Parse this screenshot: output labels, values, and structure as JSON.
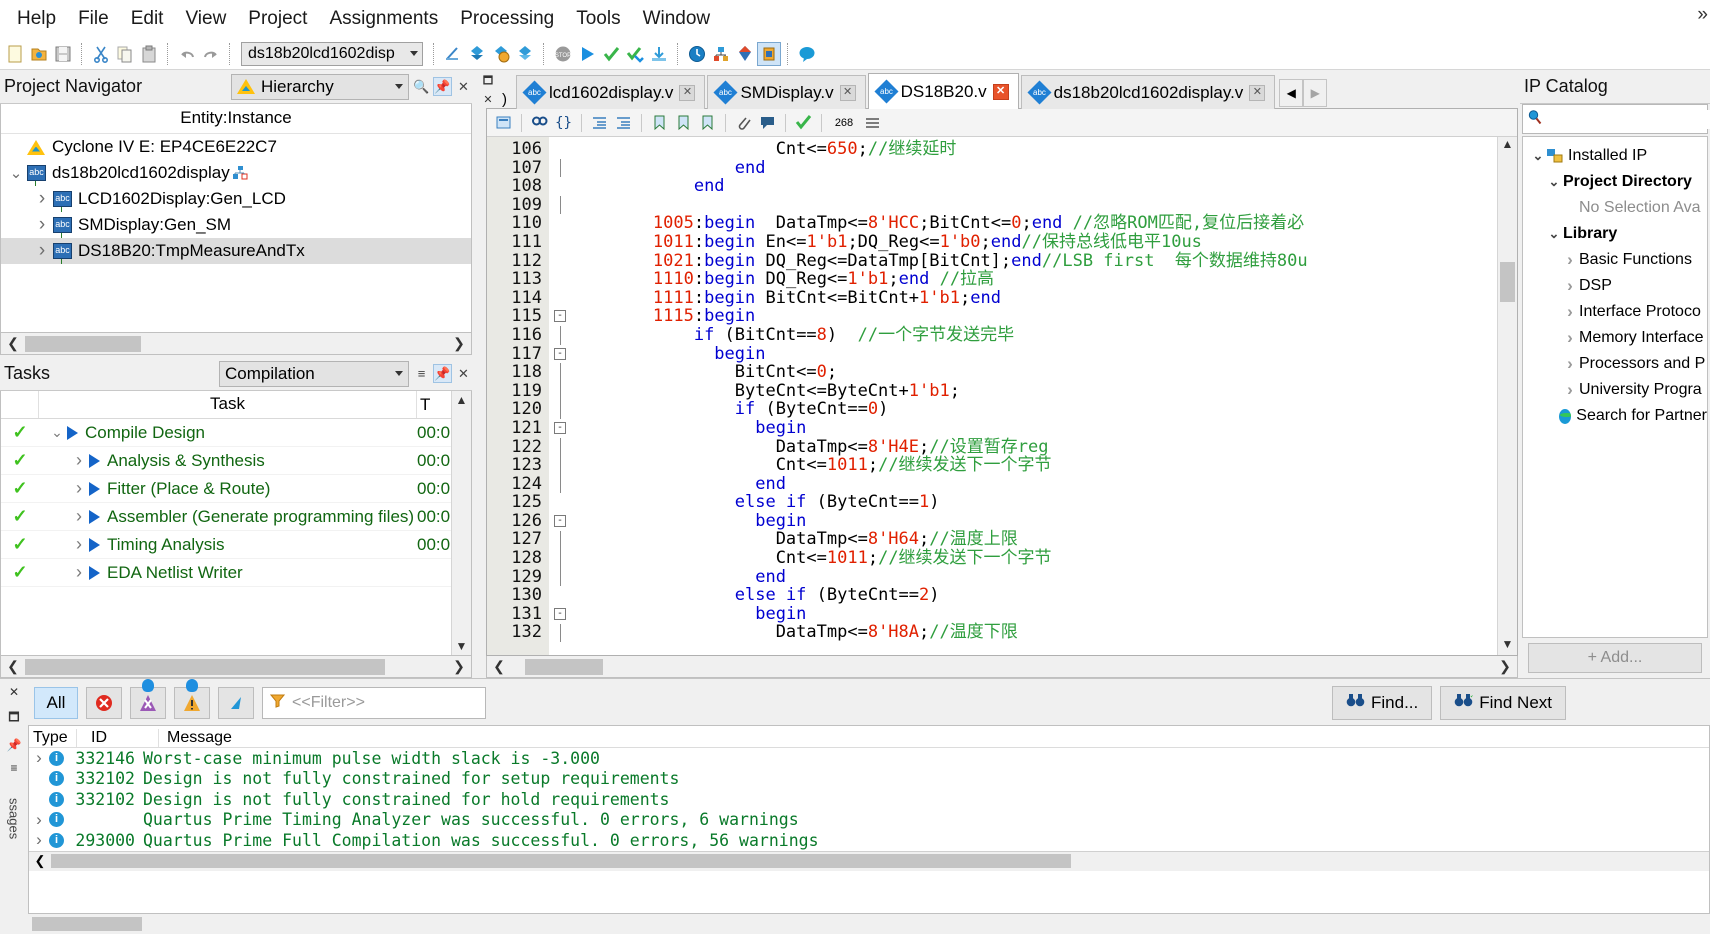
{
  "menu": {
    "items": [
      "File",
      "Edit",
      "View",
      "Project",
      "Assignments",
      "Processing",
      "Tools",
      "Window",
      "Help"
    ],
    "overflow": "»"
  },
  "toolbar": {
    "project_combo_value": "ds18b20lcd1602disp",
    "icons": [
      "new-file-icon",
      "open-folder-icon",
      "save-icon",
      "cut-icon",
      "copy-icon",
      "paste-icon",
      "undo-icon",
      "redo-icon",
      "compile-icon",
      "analysis-synthesis-icon",
      "analysis-elaboration-icon",
      "fitter-icon",
      "stop-icon",
      "start-compilation-icon",
      "timing-analyzer-icon",
      "programmer-icon",
      "download-icon",
      "clock-icon",
      "pin-planner-icon",
      "netlist-viewer-icon",
      "rtl-viewer-icon",
      "help-balloon-icon"
    ]
  },
  "project_navigator": {
    "title": "Project Navigator",
    "view_selector": "Hierarchy",
    "column_header": "Entity:Instance",
    "nodes": [
      {
        "label": "Cyclone IV E: EP4CE6E22C7",
        "depth": 0,
        "icon": "device-warning-icon",
        "twisty": "",
        "selected": false
      },
      {
        "label": "ds18b20lcd1602display",
        "depth": 0,
        "icon": "verilog-file-icon",
        "twisty": "expanded",
        "selected": false
      },
      {
        "label": "LCD1602Display:Gen_LCD",
        "depth": 1,
        "icon": "verilog-file-icon",
        "twisty": "collapsed",
        "selected": false
      },
      {
        "label": "SMDisplay:Gen_SM",
        "depth": 1,
        "icon": "verilog-file-icon",
        "twisty": "collapsed",
        "selected": false
      },
      {
        "label": "DS18B20:TmpMeasureAndTx",
        "depth": 1,
        "icon": "verilog-file-icon",
        "twisty": "collapsed",
        "selected": true
      }
    ]
  },
  "tasks": {
    "title": "Tasks",
    "flow_selector": "Compilation",
    "columns": {
      "task": "Task",
      "time": "T"
    },
    "rows": [
      {
        "label": "Compile Design",
        "time": "00:0",
        "depth": 0,
        "twisty": "expanded",
        "status": "done"
      },
      {
        "label": "Analysis & Synthesis",
        "time": "00:0",
        "depth": 1,
        "twisty": "collapsed",
        "status": "done"
      },
      {
        "label": "Fitter (Place & Route)",
        "time": "00:0",
        "depth": 1,
        "twisty": "collapsed",
        "status": "done"
      },
      {
        "label": "Assembler (Generate programming files)",
        "time": "00:0",
        "depth": 1,
        "twisty": "collapsed",
        "status": "done"
      },
      {
        "label": "Timing Analysis",
        "time": "00:0",
        "depth": 1,
        "twisty": "collapsed",
        "status": "done"
      },
      {
        "label": "EDA Netlist Writer",
        "time": "",
        "depth": 1,
        "twisty": "collapsed",
        "status": "done"
      }
    ]
  },
  "editor": {
    "tabs": [
      {
        "label": "lcd1602display.v",
        "active": false,
        "close_state": "normal"
      },
      {
        "label": "SMDisplay.v",
        "active": false,
        "close_state": "normal"
      },
      {
        "label": "DS18B20.v",
        "active": true,
        "close_state": "modified"
      },
      {
        "label": "ds18b20lcd1602display.v",
        "active": false,
        "close_state": "normal"
      }
    ],
    "toolbar_line_count": "268",
    "first_line_number": 106,
    "lines": [
      {
        "n": 106,
        "fold": "",
        "segs": [
          {
            "t": "                    Cnt<=",
            "c": ""
          },
          {
            "t": "650",
            "c": "num"
          },
          {
            "t": ";",
            "c": ""
          },
          {
            "t": "//继续延时",
            "c": "cm"
          }
        ]
      },
      {
        "n": 107,
        "fold": "bar",
        "segs": [
          {
            "t": "                ",
            "c": ""
          },
          {
            "t": "end",
            "c": "kw"
          }
        ]
      },
      {
        "n": 108,
        "fold": "",
        "segs": [
          {
            "t": "            ",
            "c": ""
          },
          {
            "t": "end",
            "c": "kw"
          }
        ]
      },
      {
        "n": 109,
        "fold": "bar",
        "segs": [
          {
            "t": "",
            "c": ""
          }
        ]
      },
      {
        "n": 110,
        "fold": "",
        "segs": [
          {
            "t": "        ",
            "c": ""
          },
          {
            "t": "1005",
            "c": "num"
          },
          {
            "t": ":",
            "c": ""
          },
          {
            "t": "begin",
            "c": "kw"
          },
          {
            "t": "  DataTmp<=",
            "c": ""
          },
          {
            "t": "8",
            "c": "num"
          },
          {
            "t": "'HCC",
            "c": "st"
          },
          {
            "t": ";BitCnt<=",
            "c": ""
          },
          {
            "t": "0",
            "c": "num"
          },
          {
            "t": ";",
            "c": ""
          },
          {
            "t": "end",
            "c": "kw"
          },
          {
            "t": " //忽略ROM匹配,复位后接着必",
            "c": "cm"
          }
        ]
      },
      {
        "n": 111,
        "fold": "",
        "segs": [
          {
            "t": "        ",
            "c": ""
          },
          {
            "t": "1011",
            "c": "num"
          },
          {
            "t": ":",
            "c": ""
          },
          {
            "t": "begin",
            "c": "kw"
          },
          {
            "t": " En<=",
            "c": ""
          },
          {
            "t": "1",
            "c": "num"
          },
          {
            "t": "'b1",
            "c": "st"
          },
          {
            "t": ";DQ_Reg<=",
            "c": ""
          },
          {
            "t": "1",
            "c": "num"
          },
          {
            "t": "'b0",
            "c": "st"
          },
          {
            "t": ";",
            "c": ""
          },
          {
            "t": "end",
            "c": "kw"
          },
          {
            "t": "//保持总线低电平10us",
            "c": "cm"
          }
        ]
      },
      {
        "n": 112,
        "fold": "",
        "segs": [
          {
            "t": "        ",
            "c": ""
          },
          {
            "t": "1021",
            "c": "num"
          },
          {
            "t": ":",
            "c": ""
          },
          {
            "t": "begin",
            "c": "kw"
          },
          {
            "t": " DQ_Reg<=DataTmp[BitCnt];",
            "c": ""
          },
          {
            "t": "end",
            "c": "kw"
          },
          {
            "t": "//LSB first  每个数据维持80u",
            "c": "cm"
          }
        ]
      },
      {
        "n": 113,
        "fold": "",
        "segs": [
          {
            "t": "        ",
            "c": ""
          },
          {
            "t": "1110",
            "c": "num"
          },
          {
            "t": ":",
            "c": ""
          },
          {
            "t": "begin",
            "c": "kw"
          },
          {
            "t": " DQ_Reg<=",
            "c": ""
          },
          {
            "t": "1",
            "c": "num"
          },
          {
            "t": "'b1",
            "c": "st"
          },
          {
            "t": ";",
            "c": ""
          },
          {
            "t": "end",
            "c": "kw"
          },
          {
            "t": " //拉高",
            "c": "cm"
          }
        ]
      },
      {
        "n": 114,
        "fold": "",
        "segs": [
          {
            "t": "        ",
            "c": ""
          },
          {
            "t": "1111",
            "c": "num"
          },
          {
            "t": ":",
            "c": ""
          },
          {
            "t": "begin",
            "c": "kw"
          },
          {
            "t": " BitCnt<=BitCnt+",
            "c": ""
          },
          {
            "t": "1",
            "c": "num"
          },
          {
            "t": "'b1",
            "c": "st"
          },
          {
            "t": ";",
            "c": ""
          },
          {
            "t": "end",
            "c": "kw"
          }
        ]
      },
      {
        "n": 115,
        "fold": "minus",
        "segs": [
          {
            "t": "        ",
            "c": ""
          },
          {
            "t": "1115",
            "c": "num"
          },
          {
            "t": ":",
            "c": ""
          },
          {
            "t": "begin",
            "c": "kw"
          }
        ]
      },
      {
        "n": 116,
        "fold": "bar",
        "segs": [
          {
            "t": "            ",
            "c": ""
          },
          {
            "t": "if",
            "c": "kw"
          },
          {
            "t": " (BitCnt==",
            "c": ""
          },
          {
            "t": "8",
            "c": "num"
          },
          {
            "t": ")  ",
            "c": ""
          },
          {
            "t": "//一个字节发送完毕",
            "c": "cm"
          }
        ]
      },
      {
        "n": 117,
        "fold": "minus",
        "segs": [
          {
            "t": "              ",
            "c": ""
          },
          {
            "t": "begin",
            "c": "kw"
          }
        ]
      },
      {
        "n": 118,
        "fold": "bar",
        "segs": [
          {
            "t": "                BitCnt<=",
            "c": ""
          },
          {
            "t": "0",
            "c": "num"
          },
          {
            "t": ";",
            "c": ""
          }
        ]
      },
      {
        "n": 119,
        "fold": "bar",
        "segs": [
          {
            "t": "                ByteCnt<=ByteCnt+",
            "c": ""
          },
          {
            "t": "1",
            "c": "num"
          },
          {
            "t": "'b1",
            "c": "st"
          },
          {
            "t": ";",
            "c": ""
          }
        ]
      },
      {
        "n": 120,
        "fold": "bar",
        "segs": [
          {
            "t": "                ",
            "c": ""
          },
          {
            "t": "if",
            "c": "kw"
          },
          {
            "t": " (ByteCnt==",
            "c": ""
          },
          {
            "t": "0",
            "c": "num"
          },
          {
            "t": ")",
            "c": ""
          }
        ]
      },
      {
        "n": 121,
        "fold": "minus",
        "segs": [
          {
            "t": "                  ",
            "c": ""
          },
          {
            "t": "begin",
            "c": "kw"
          }
        ]
      },
      {
        "n": 122,
        "fold": "bar",
        "segs": [
          {
            "t": "                    DataTmp<=",
            "c": ""
          },
          {
            "t": "8",
            "c": "num"
          },
          {
            "t": "'H4E",
            "c": "st"
          },
          {
            "t": ";",
            "c": ""
          },
          {
            "t": "//设置暂存reg",
            "c": "cm"
          }
        ]
      },
      {
        "n": 123,
        "fold": "bar",
        "segs": [
          {
            "t": "                    Cnt<=",
            "c": ""
          },
          {
            "t": "1011",
            "c": "num"
          },
          {
            "t": ";",
            "c": ""
          },
          {
            "t": "//继续发送下一个字节",
            "c": "cm"
          }
        ]
      },
      {
        "n": 124,
        "fold": "bar",
        "segs": [
          {
            "t": "                  ",
            "c": ""
          },
          {
            "t": "end",
            "c": "kw"
          }
        ]
      },
      {
        "n": 125,
        "fold": "",
        "segs": [
          {
            "t": "                ",
            "c": ""
          },
          {
            "t": "else if",
            "c": "kw"
          },
          {
            "t": " (ByteCnt==",
            "c": ""
          },
          {
            "t": "1",
            "c": "num"
          },
          {
            "t": ")",
            "c": ""
          }
        ]
      },
      {
        "n": 126,
        "fold": "minus",
        "segs": [
          {
            "t": "                  ",
            "c": ""
          },
          {
            "t": "begin",
            "c": "kw"
          }
        ]
      },
      {
        "n": 127,
        "fold": "bar",
        "segs": [
          {
            "t": "                    DataTmp<=",
            "c": ""
          },
          {
            "t": "8",
            "c": "num"
          },
          {
            "t": "'H64",
            "c": "st"
          },
          {
            "t": ";",
            "c": ""
          },
          {
            "t": "//温度上限",
            "c": "cm"
          }
        ]
      },
      {
        "n": 128,
        "fold": "bar",
        "segs": [
          {
            "t": "                    Cnt<=",
            "c": ""
          },
          {
            "t": "1011",
            "c": "num"
          },
          {
            "t": ";",
            "c": ""
          },
          {
            "t": "//继续发送下一个字节",
            "c": "cm"
          }
        ]
      },
      {
        "n": 129,
        "fold": "bar",
        "segs": [
          {
            "t": "                  ",
            "c": ""
          },
          {
            "t": "end",
            "c": "kw"
          }
        ]
      },
      {
        "n": 130,
        "fold": "",
        "segs": [
          {
            "t": "                ",
            "c": ""
          },
          {
            "t": "else if",
            "c": "kw"
          },
          {
            "t": " (ByteCnt==",
            "c": ""
          },
          {
            "t": "2",
            "c": "num"
          },
          {
            "t": ")",
            "c": ""
          }
        ]
      },
      {
        "n": 131,
        "fold": "minus",
        "segs": [
          {
            "t": "                  ",
            "c": ""
          },
          {
            "t": "begin",
            "c": "kw"
          }
        ]
      },
      {
        "n": 132,
        "fold": "bar",
        "segs": [
          {
            "t": "                    DataTmp<=",
            "c": ""
          },
          {
            "t": "8",
            "c": "num"
          },
          {
            "t": "'H8A",
            "c": "st"
          },
          {
            "t": ";",
            "c": ""
          },
          {
            "t": "//温度下限",
            "c": "cm"
          }
        ]
      }
    ]
  },
  "ip_catalog": {
    "title": "IP Catalog",
    "search_placeholder": "",
    "nodes": [
      {
        "label": "Installed IP",
        "depth": 0,
        "twisty": "expanded",
        "bold": false,
        "icon": "installed-ip-icon"
      },
      {
        "label": "Project Directory",
        "depth": 1,
        "twisty": "expanded",
        "bold": true,
        "icon": ""
      },
      {
        "label": "No Selection Ava",
        "depth": 2,
        "twisty": "",
        "bold": false,
        "icon": "",
        "muted": true
      },
      {
        "label": "Library",
        "depth": 1,
        "twisty": "expanded",
        "bold": true,
        "icon": ""
      },
      {
        "label": "Basic Functions",
        "depth": 2,
        "twisty": "collapsed",
        "bold": false,
        "icon": ""
      },
      {
        "label": "DSP",
        "depth": 2,
        "twisty": "collapsed",
        "bold": false,
        "icon": ""
      },
      {
        "label": "Interface Protoco",
        "depth": 2,
        "twisty": "collapsed",
        "bold": false,
        "icon": ""
      },
      {
        "label": "Memory Interface",
        "depth": 2,
        "twisty": "collapsed",
        "bold": false,
        "icon": ""
      },
      {
        "label": "Processors and P",
        "depth": 2,
        "twisty": "collapsed",
        "bold": false,
        "icon": ""
      },
      {
        "label": "University Progra",
        "depth": 2,
        "twisty": "collapsed",
        "bold": false,
        "icon": ""
      },
      {
        "label": "Search for Partner",
        "depth": 1,
        "twisty": "",
        "bold": false,
        "icon": "globe-icon"
      }
    ],
    "add_button": "+  Add..."
  },
  "messages": {
    "filter_all_label": "All",
    "filter_placeholder": "<<Filter>>",
    "find_label": "Find...",
    "find_next_label": "Find Next",
    "columns": [
      "Type",
      "ID",
      "Message"
    ],
    "rows": [
      {
        "twisty": "collapsed",
        "severity": "info",
        "id": "332146",
        "text": "Worst-case minimum pulse width slack is -3.000"
      },
      {
        "twisty": "",
        "severity": "info",
        "id": "332102",
        "text": "Design is not fully constrained for setup requirements"
      },
      {
        "twisty": "",
        "severity": "info",
        "id": "332102",
        "text": "Design is not fully constrained for hold requirements"
      },
      {
        "twisty": "collapsed",
        "severity": "info",
        "id": "",
        "text": "Quartus Prime Timing Analyzer was successful. 0 errors, 6 warnings"
      },
      {
        "twisty": "collapsed",
        "severity": "info",
        "id": "293000",
        "text": "Quartus Prime Full Compilation was successful. 0 errors, 56 warnings"
      }
    ],
    "side_label": "ssages"
  }
}
